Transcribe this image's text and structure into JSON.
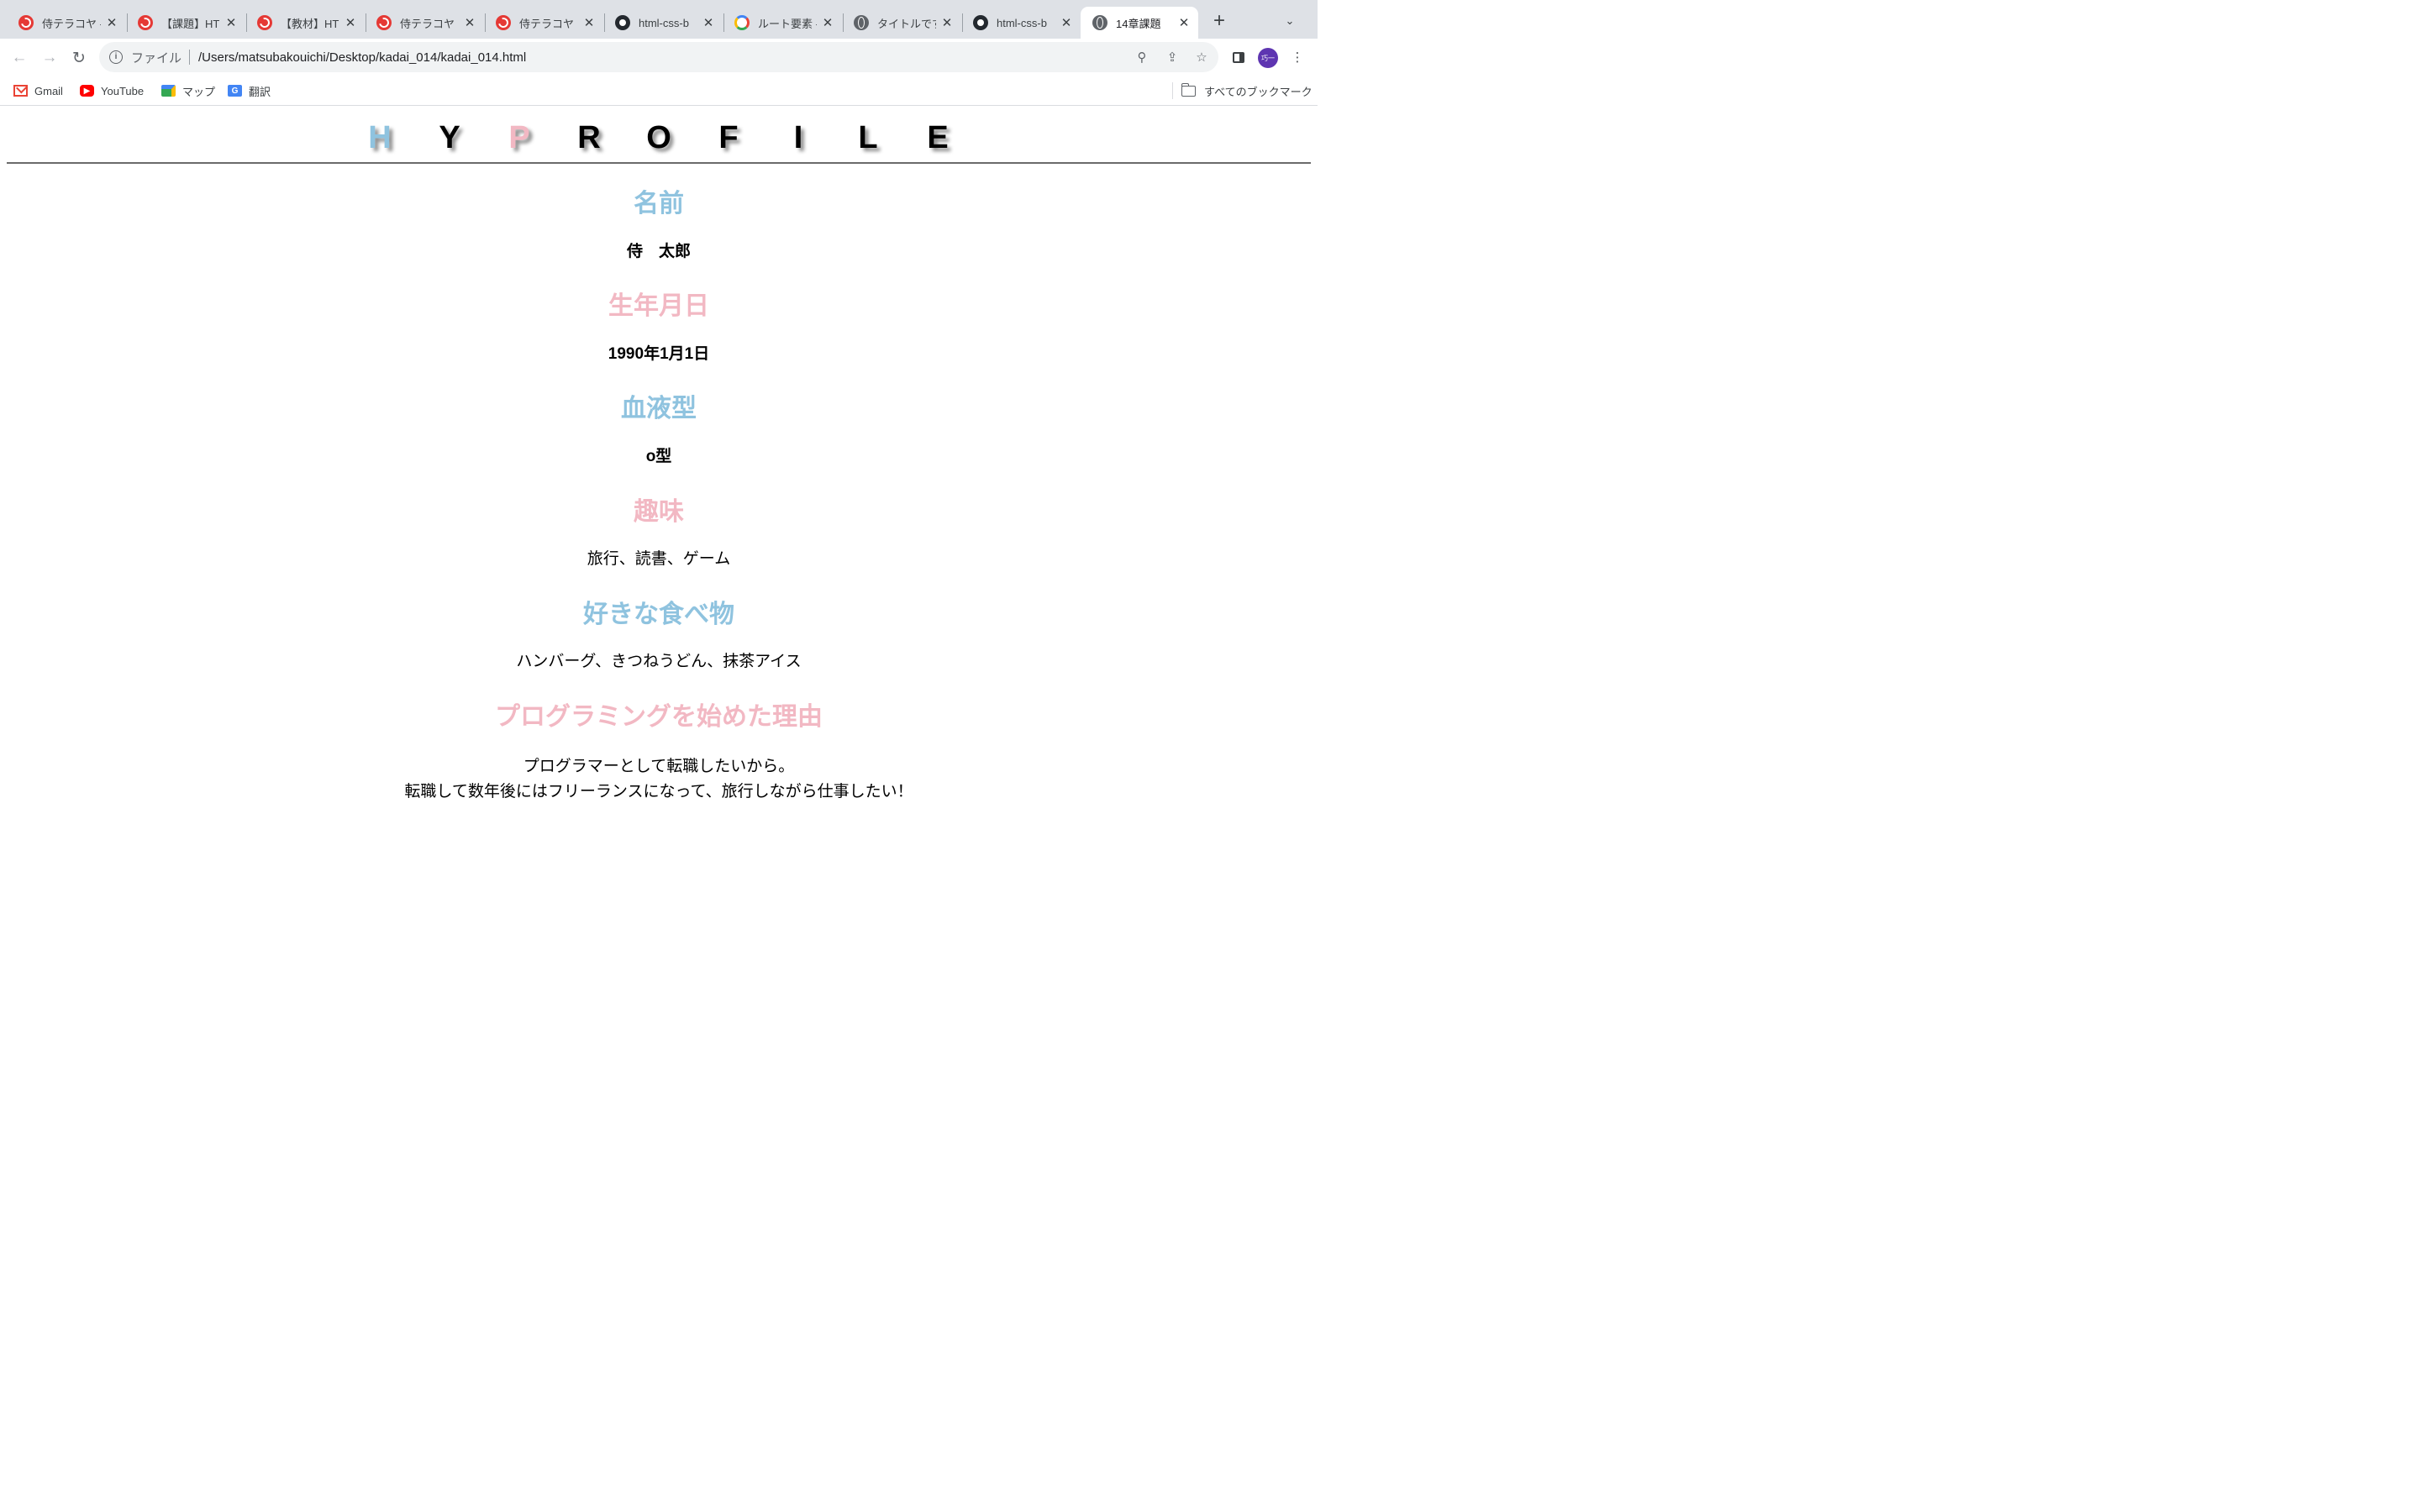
{
  "tabs": [
    {
      "title": "侍テラコヤ -",
      "favicon": "samurai-icon"
    },
    {
      "title": "【課題】HT",
      "favicon": "samurai-icon"
    },
    {
      "title": "【教材】HT",
      "favicon": "samurai-icon"
    },
    {
      "title": "侍テラコヤ",
      "favicon": "samurai-icon"
    },
    {
      "title": "侍テラコヤ",
      "favicon": "samurai-icon"
    },
    {
      "title": "html-css-b",
      "favicon": "github-icon"
    },
    {
      "title": "ルート要素 -",
      "favicon": "google-icon"
    },
    {
      "title": "タイトルです",
      "favicon": "globe-icon"
    },
    {
      "title": "html-css-b",
      "favicon": "github-icon"
    },
    {
      "title": "14章課題",
      "favicon": "globe-icon",
      "active": true
    }
  ],
  "toolbar": {
    "new_tab_symbol": "+",
    "scheme_label": "ファイル",
    "url": "/Users/matsubakouichi/Desktop/kadai_014/kadai_014.html",
    "avatar_text": "巧一"
  },
  "bookmarks": {
    "items": [
      {
        "label": "Gmail",
        "icon": "gmail-icon"
      },
      {
        "label": "YouTube",
        "icon": "youtube-icon"
      },
      {
        "label": "マップ",
        "icon": "maps-icon"
      },
      {
        "label": "翻訳",
        "icon": "translate-icon"
      }
    ],
    "all_bookmarks": "すべてのブックマーク"
  },
  "page": {
    "hero_letters": [
      "H",
      "Y",
      "P",
      "R",
      "O",
      "F",
      "I",
      "L",
      "E"
    ],
    "sections": [
      {
        "title": "名前",
        "value": "侍　太郎",
        "accent": "blue",
        "bold_value": true
      },
      {
        "title": "生年月日",
        "value": "1990年1月1日",
        "accent": "pink",
        "bold_value": true
      },
      {
        "title": "血液型",
        "value": "o型",
        "accent": "blue",
        "bold_value": true
      },
      {
        "title": "趣味",
        "value": "旅行、読書、ゲーム",
        "accent": "pink",
        "bold_value": false
      },
      {
        "title": "好きな食べ物",
        "value": "ハンバーグ、きつねうどん、抹茶アイス",
        "accent": "blue",
        "bold_value": false
      },
      {
        "title": "プログラミングを始めた理由",
        "value": "プログラマーとして転職したいから。",
        "value2": "転職して数年後にはフリーランスになって、旅行しながら仕事したい！",
        "accent": "pink",
        "bold_value": false
      }
    ]
  },
  "colors": {
    "accent_blue": "#8fc3df",
    "accent_pink": "#f2b8c3",
    "tabstrip": "#dee1e6"
  }
}
